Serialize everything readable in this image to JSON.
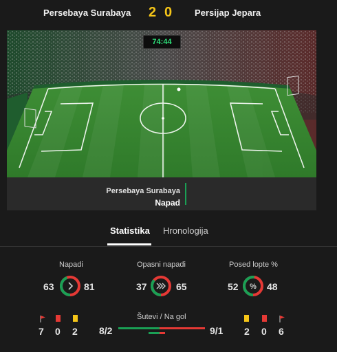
{
  "match": {
    "home_team": "Persebaya Surabaya",
    "away_team": "Persijap Jepara",
    "home_score": "2",
    "away_score": "0",
    "clock": "74:44"
  },
  "event": {
    "team": "Persebaya Surabaya",
    "type": "Napad"
  },
  "tabs": {
    "active": "Statistika",
    "other": "Hronologija"
  },
  "stats": {
    "attacks": {
      "label": "Napadi",
      "home": "63",
      "away": "81",
      "home_share": 0.44
    },
    "dangerous": {
      "label": "Opasni napadi",
      "home": "37",
      "away": "65",
      "home_share": 0.36
    },
    "possession": {
      "label": "Posed lopte %",
      "home": "52",
      "away": "48",
      "home_share": 0.52,
      "symbol": "%"
    },
    "shots": {
      "label": "Šutevi / Na gol",
      "home": "8/2",
      "away": "9/1"
    }
  },
  "cards": {
    "home": {
      "corners": "7",
      "red": "0",
      "yellow": "2"
    },
    "away": {
      "yellow": "2",
      "red": "0",
      "corners": "6"
    }
  },
  "colors": {
    "home": "#1aa055",
    "away": "#e53935",
    "score": "#f5c518"
  }
}
